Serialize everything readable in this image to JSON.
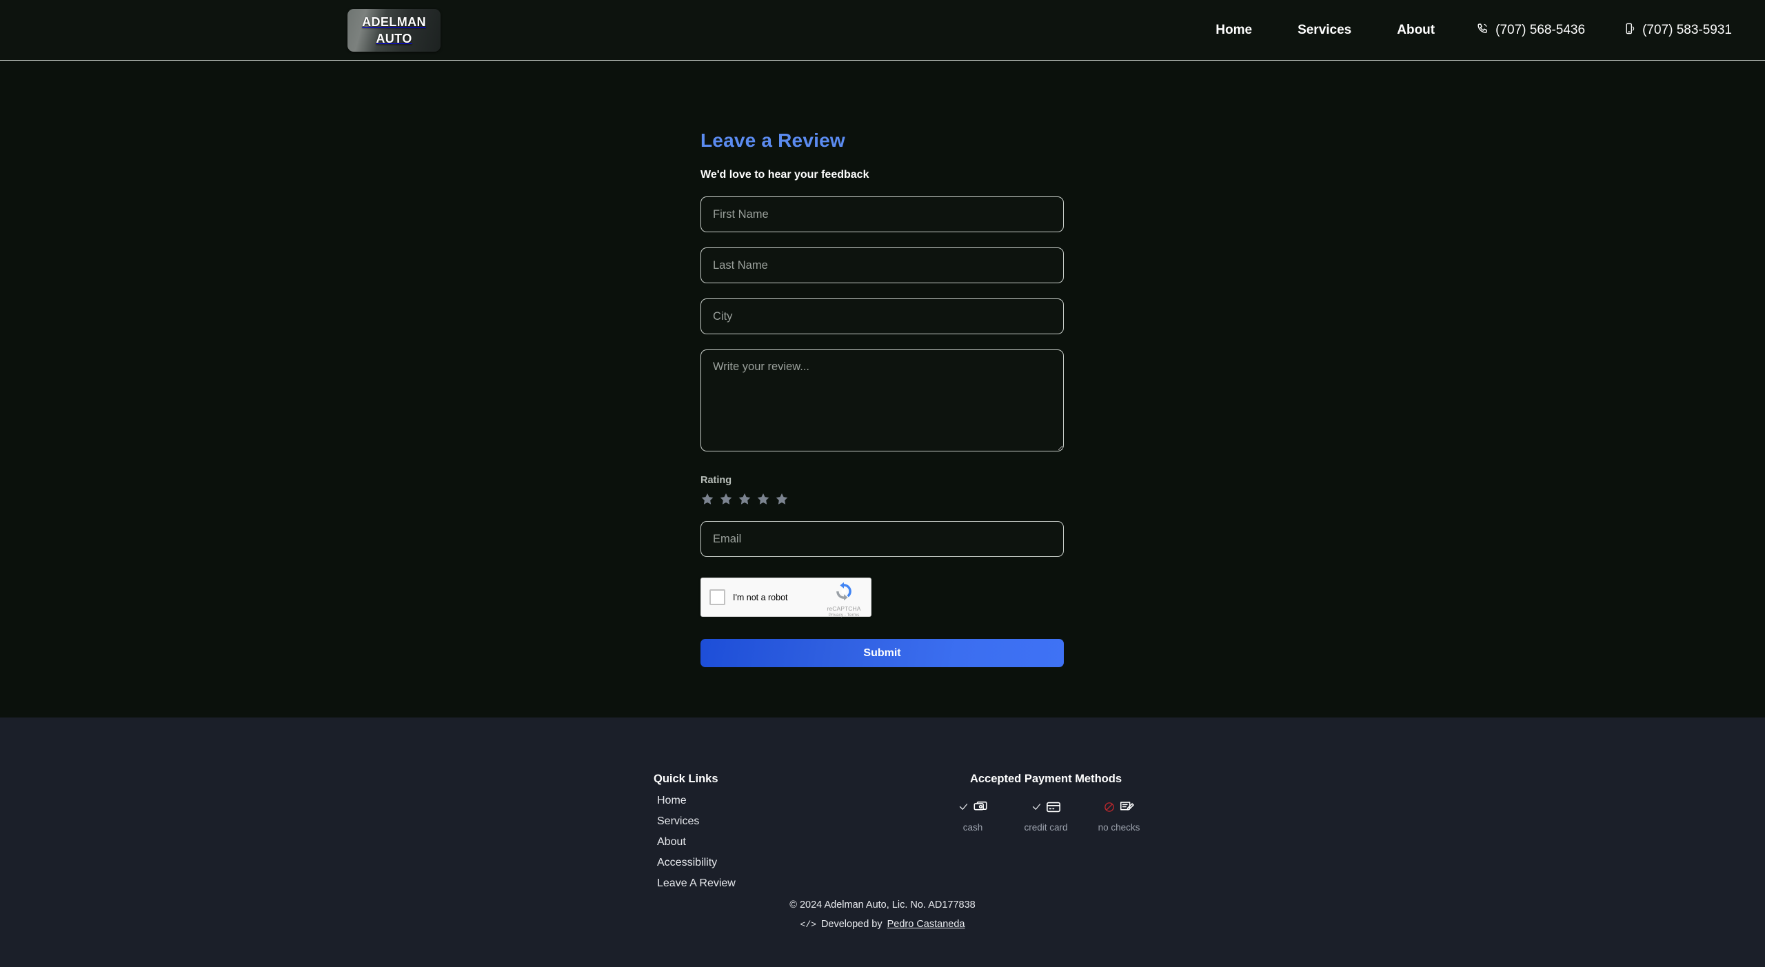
{
  "colors": {
    "page_bg": "#0b110c",
    "header_bg": "#0d130e",
    "footer_bg": "#1b1f29",
    "accent_heading": "#5b8bf0",
    "submit_gradient_start": "#1d4ed8",
    "submit_gradient_end": "#3f72f5",
    "star_inactive": "#7c8490",
    "no_check_red": "#c0282d",
    "field_border": "#c8cec9"
  },
  "header": {
    "logo": {
      "line1": "ADELMAN",
      "line2": "AUTO",
      "icon": "logo-badge"
    },
    "nav": [
      {
        "label": "Home",
        "name": "nav-home"
      },
      {
        "label": "Services",
        "name": "nav-services"
      },
      {
        "label": "About",
        "name": "nav-about"
      }
    ],
    "phones": [
      {
        "label": "(707) 568-5436",
        "icon": "landline-phone-icon",
        "name": "nav-phone-landline"
      },
      {
        "label": "(707) 583-5931",
        "icon": "mobile-phone-icon",
        "name": "nav-phone-mobile"
      }
    ]
  },
  "form": {
    "title": "Leave a Review",
    "subtitle": "We'd love to hear your feedback",
    "fields": [
      {
        "name": "first-name-input",
        "placeholder": "First Name",
        "value": ""
      },
      {
        "name": "last-name-input",
        "placeholder": "Last Name",
        "value": ""
      },
      {
        "name": "city-input",
        "placeholder": "City",
        "value": ""
      }
    ],
    "review": {
      "placeholder": "Write your review...",
      "value": ""
    },
    "rating": {
      "label": "Rating",
      "stars_total": 5,
      "stars_selected": 0
    },
    "email": {
      "placeholder": "Email",
      "value": ""
    },
    "recaptcha": {
      "checkbox_label": "I'm not a robot",
      "brand": "reCAPTCHA",
      "legal": "Privacy - Terms",
      "checked": false
    },
    "submit_label": "Submit"
  },
  "footer": {
    "quick_links": {
      "title": "Quick Links",
      "items": [
        {
          "label": "Home",
          "name": "footer-link-home"
        },
        {
          "label": "Services",
          "name": "footer-link-services"
        },
        {
          "label": "About",
          "name": "footer-link-about"
        },
        {
          "label": "Accessibility",
          "name": "footer-link-accessibility"
        },
        {
          "label": "Leave A Review",
          "name": "footer-link-leave-a-review"
        }
      ]
    },
    "payments": {
      "title": "Accepted Payment Methods",
      "items": [
        {
          "label": "cash",
          "icon": "cash-icon",
          "status_icon": "check-icon",
          "accepted": true
        },
        {
          "label": "credit card",
          "icon": "credit-card-icon",
          "status_icon": "check-icon",
          "accepted": true
        },
        {
          "label": "no checks",
          "icon": "check-writing-icon",
          "status_icon": "prohibited-icon",
          "accepted": false
        }
      ]
    },
    "copyright": "© 2024 Adelman Auto, Lic. No. AD177838",
    "developed_by_prefix": "Developed by",
    "developer_name": "Pedro Castaneda",
    "code_glyph": "</>"
  }
}
